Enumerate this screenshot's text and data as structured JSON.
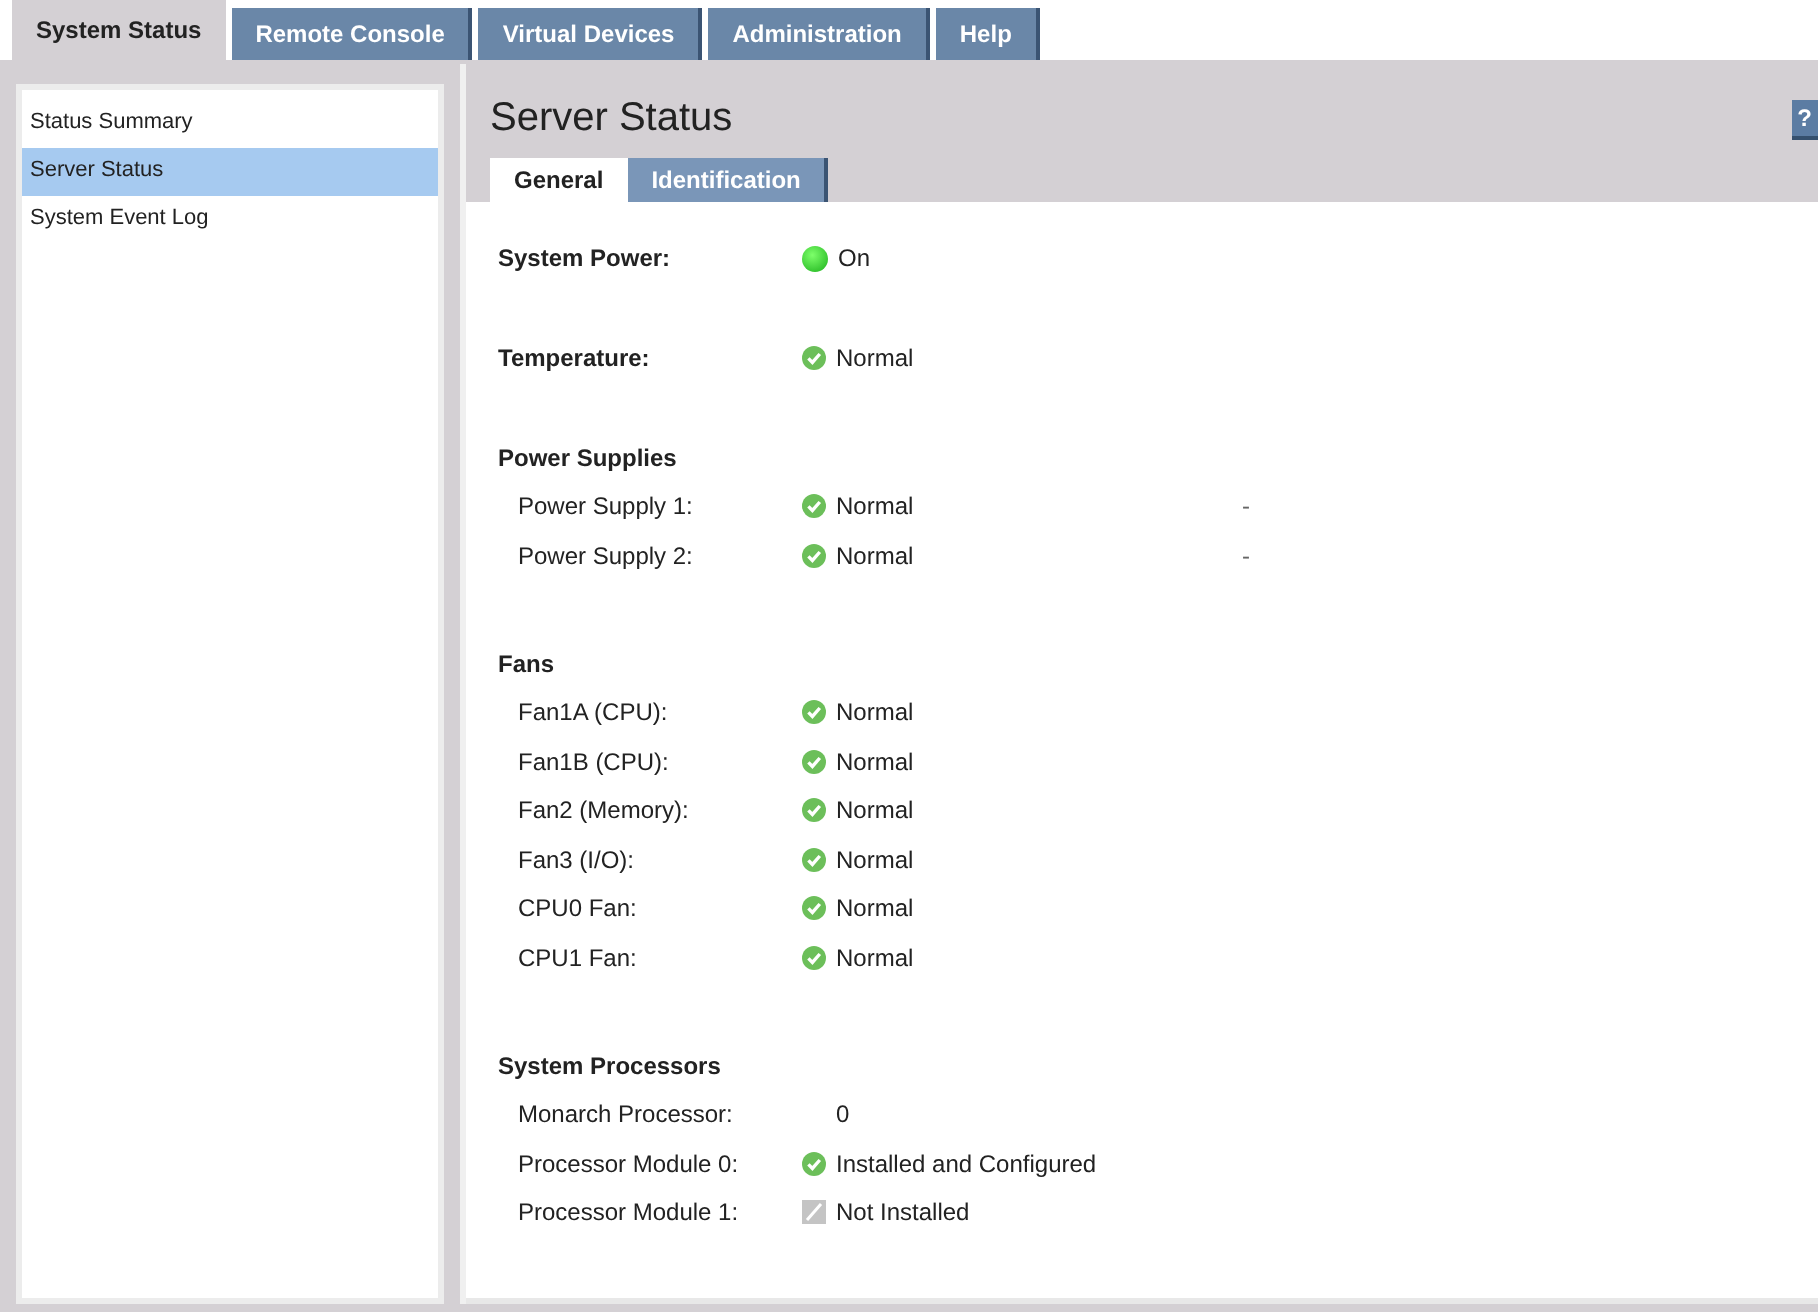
{
  "top_tabs": [
    {
      "label": "System Status",
      "selected": true
    },
    {
      "label": "Remote Console",
      "selected": false
    },
    {
      "label": "Virtual Devices",
      "selected": false
    },
    {
      "label": "Administration",
      "selected": false
    },
    {
      "label": "Help",
      "selected": false
    }
  ],
  "sidebar": {
    "items": [
      {
        "label": "Status Summary",
        "selected": false
      },
      {
        "label": "Server Status",
        "selected": true
      },
      {
        "label": "System Event Log",
        "selected": false
      }
    ]
  },
  "page": {
    "title": "Server Status",
    "help": "?",
    "tabs": [
      {
        "label": "General",
        "selected": true
      },
      {
        "label": "Identification",
        "selected": false
      }
    ]
  },
  "sections": [
    {
      "kind": "inline",
      "label": "System Power:",
      "status": {
        "kind": "on",
        "text": "On"
      }
    },
    {
      "kind": "inline",
      "label": "Temperature:",
      "status": {
        "kind": "ok",
        "text": "Normal"
      }
    },
    {
      "kind": "group",
      "heading": "Power Supplies",
      "rows": [
        {
          "label": "Power Supply 1:",
          "status": {
            "kind": "ok",
            "text": "Normal"
          },
          "extra": "-"
        },
        {
          "label": "Power Supply 2:",
          "status": {
            "kind": "ok",
            "text": "Normal"
          },
          "extra": "-"
        }
      ]
    },
    {
      "kind": "group",
      "heading": "Fans",
      "rows": [
        {
          "label": "Fan1A (CPU):",
          "status": {
            "kind": "ok",
            "text": "Normal"
          }
        },
        {
          "label": "Fan1B (CPU):",
          "status": {
            "kind": "ok",
            "text": "Normal"
          }
        },
        {
          "label": "Fan2 (Memory):",
          "status": {
            "kind": "ok",
            "text": "Normal"
          }
        },
        {
          "label": "Fan3 (I/O):",
          "status": {
            "kind": "ok",
            "text": "Normal"
          }
        },
        {
          "label": "CPU0 Fan:",
          "status": {
            "kind": "ok",
            "text": "Normal"
          }
        },
        {
          "label": "CPU1 Fan:",
          "status": {
            "kind": "ok",
            "text": "Normal"
          }
        }
      ]
    },
    {
      "kind": "group",
      "heading": "System Processors",
      "rows": [
        {
          "label": "Monarch Processor:",
          "status": {
            "kind": "plain",
            "text": "0"
          }
        },
        {
          "label": "Processor Module 0:",
          "status": {
            "kind": "ok",
            "text": "Installed and Configured"
          }
        },
        {
          "label": "Processor Module 1:",
          "status": {
            "kind": "absent",
            "text": "Not Installed"
          }
        }
      ]
    }
  ]
}
